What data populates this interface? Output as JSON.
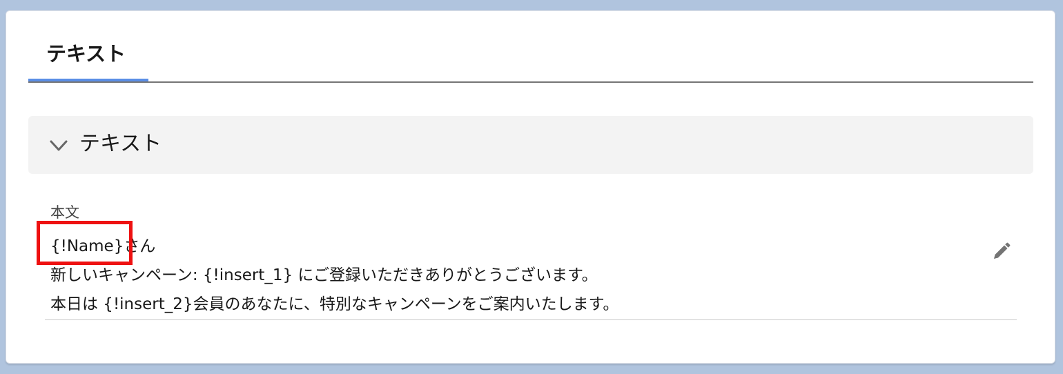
{
  "tabs": [
    {
      "label": "テキスト",
      "active": true
    }
  ],
  "section": {
    "title": "テキスト",
    "expanded": true
  },
  "field": {
    "label": "本文",
    "lines": [
      "{!Name}さん",
      "新しいキャンペーン: {!insert_1} にご登録いただきありがとうございます。",
      "本日は {!insert_2}会員のあなたに、特別なキャンペーンをご案内いたします。"
    ]
  },
  "icons": {
    "chevron": "chevron-down-icon",
    "edit": "pencil-icon"
  },
  "colors": {
    "background": "#b0c4de",
    "active_tab_underline": "#5a8ee6",
    "section_header_bg": "#f3f3f3",
    "highlight_annotation": "#ee1111"
  }
}
